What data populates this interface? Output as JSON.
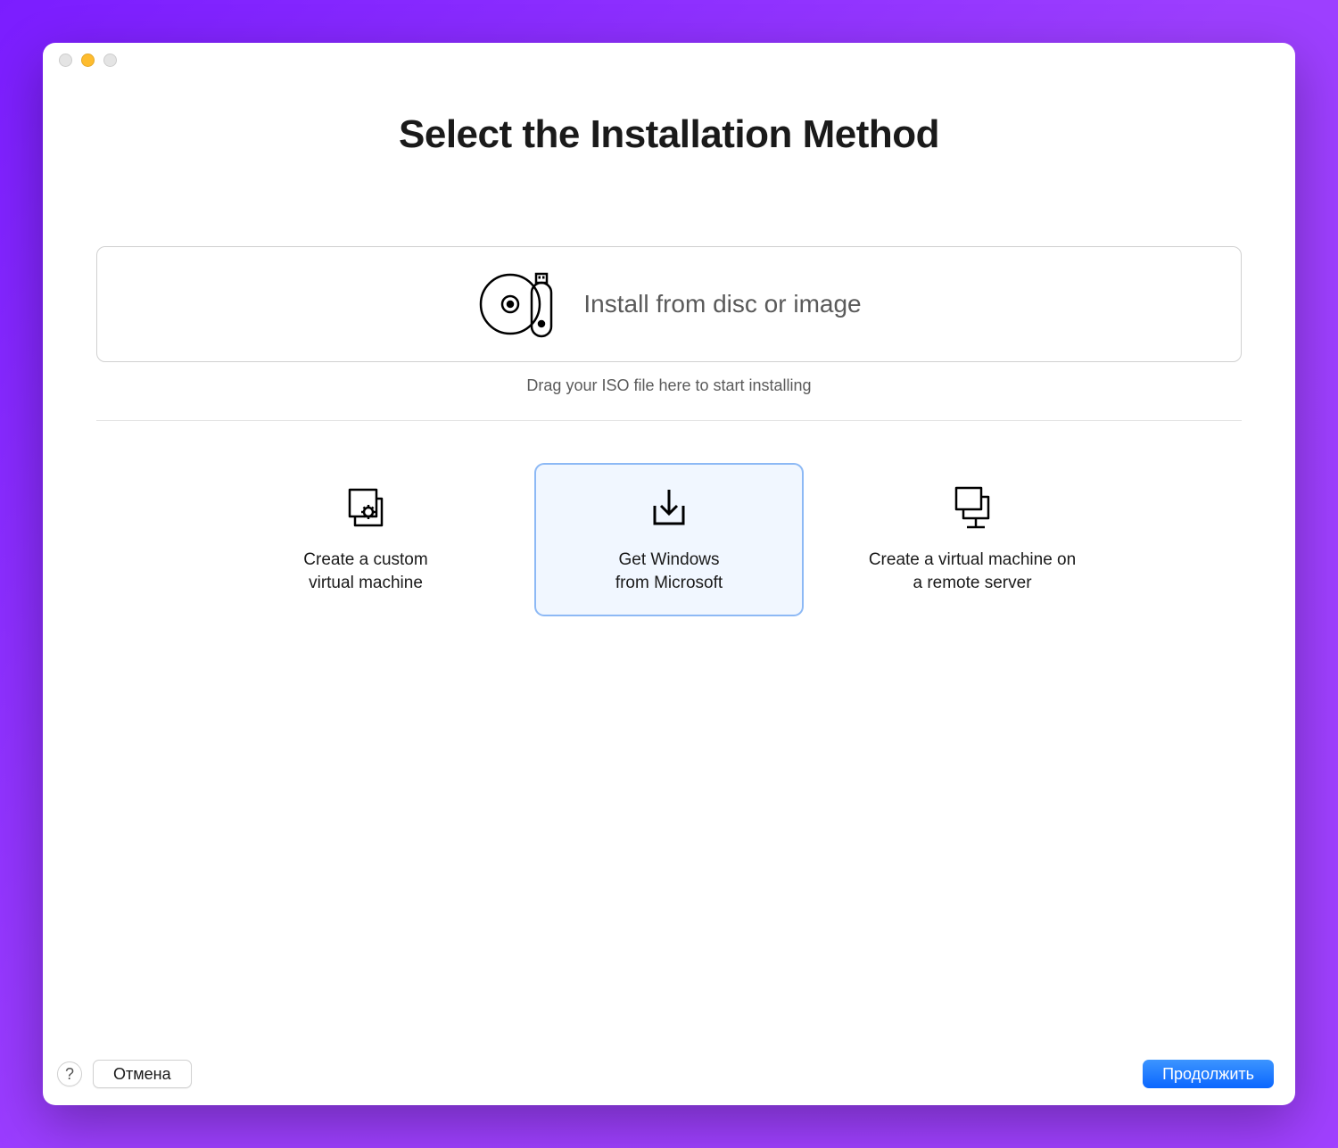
{
  "title": "Select the Installation Method",
  "dropzone": {
    "label": "Install from disc or image",
    "hint": "Drag your ISO file here to start installing"
  },
  "options": {
    "custom_vm": "Create a custom\nvirtual machine",
    "get_windows": "Get Windows\nfrom Microsoft",
    "remote_vm": "Create a virtual machine on\na remote server"
  },
  "footer": {
    "help": "?",
    "cancel": "Отмена",
    "continue": "Продолжить"
  },
  "selected_option": "get_windows",
  "colors": {
    "accent": "#0a66ff",
    "selection_border": "#8db9f5",
    "selection_bg": "#f1f7ff"
  }
}
